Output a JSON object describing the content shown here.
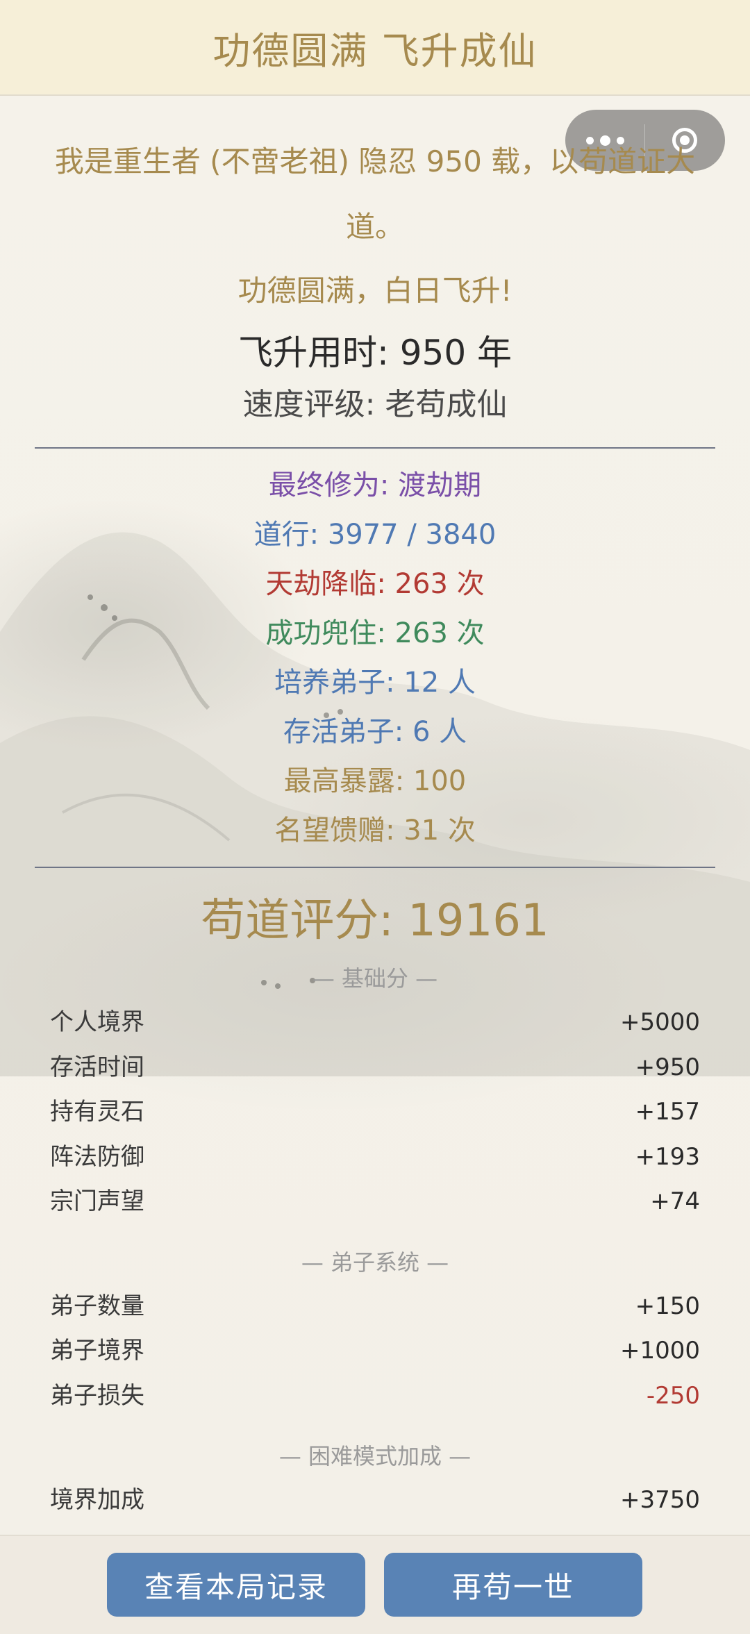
{
  "header": {
    "title": "功德圆满 飞升成仙"
  },
  "intro": {
    "line1": "我是重生者 (不啻老祖) 隐忍 950 载，以苟道证大",
    "line2": "道。",
    "subtitle": "功德圆满，白日飞升!"
  },
  "summary": {
    "time": "飞升用时: 950 年",
    "rank": "速度评级: 老苟成仙"
  },
  "stats": [
    {
      "text": "最终修为: 渡劫期",
      "color": "#7a4fa8"
    },
    {
      "text": "道行: 3977 / 3840",
      "color": "#4f79b3"
    },
    {
      "text": "天劫降临: 263 次",
      "color": "#b23a33"
    },
    {
      "text": "成功兜住: 263 次",
      "color": "#3f8a5c"
    },
    {
      "text": "培养弟子: 12 人",
      "color": "#4f79b3"
    },
    {
      "text": "存活弟子: 6 人",
      "color": "#4f79b3"
    },
    {
      "text": "最高暴露: 100",
      "color": "#a68a4e"
    },
    {
      "text": "名望馈赠: 31 次",
      "color": "#a68a4e"
    }
  ],
  "score": {
    "text": "苟道评分: 19161"
  },
  "sections": [
    {
      "title": "— 基础分 —",
      "rows": [
        {
          "label": "个人境界",
          "value": "+5000",
          "negative": false
        },
        {
          "label": "存活时间",
          "value": "+950",
          "negative": false
        },
        {
          "label": "持有灵石",
          "value": "+157",
          "negative": false
        },
        {
          "label": "阵法防御",
          "value": "+193",
          "negative": false
        },
        {
          "label": "宗门声望",
          "value": "+74",
          "negative": false
        }
      ]
    },
    {
      "title": "— 弟子系统 —",
      "rows": [
        {
          "label": "弟子数量",
          "value": "+150",
          "negative": false
        },
        {
          "label": "弟子境界",
          "value": "+1000",
          "negative": false
        },
        {
          "label": "弟子损失",
          "value": "-250",
          "negative": true
        }
      ]
    },
    {
      "title": "— 困难模式加成 —",
      "rows": [
        {
          "label": "境界加成",
          "value": "+3750",
          "negative": false
        }
      ]
    }
  ],
  "footer": {
    "records_button": "查看本局记录",
    "again_button": "再苟一世"
  },
  "colors": {
    "accent_gold": "#a68a4e",
    "button_blue": "#5983b5",
    "negative_red": "#b23a33"
  },
  "icons": {
    "more": "more-dots-icon",
    "close": "close-circle-icon"
  }
}
